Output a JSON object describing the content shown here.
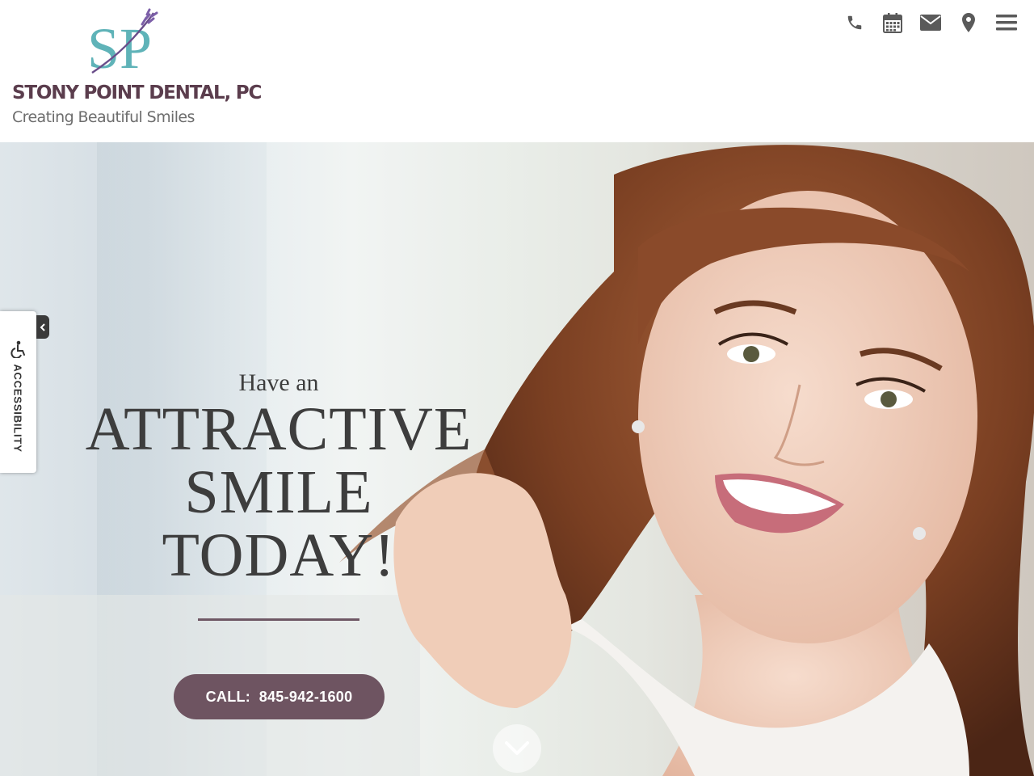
{
  "brand": {
    "logo_letters": "SP",
    "name": "STONY POINT DENTAL, PC",
    "tagline": "Creating Beautiful Smiles",
    "logo_color": "#5fb3b8",
    "name_color": "#5b3d4d"
  },
  "top_nav": {
    "icons": [
      "phone-icon",
      "calendar-icon",
      "envelope-icon",
      "map-marker-icon",
      "hamburger-menu-icon"
    ],
    "icon_color": "#5a5a5a"
  },
  "hero": {
    "pre_heading": "Have an",
    "heading_lines": [
      "ATTRACTIVE",
      "SMILE",
      "TODAY!"
    ],
    "call_label": "CALL:",
    "call_number": "845-942-1600",
    "accent_color": "#6e5461"
  },
  "accessibility": {
    "label": "ACCESSIBILITY"
  }
}
